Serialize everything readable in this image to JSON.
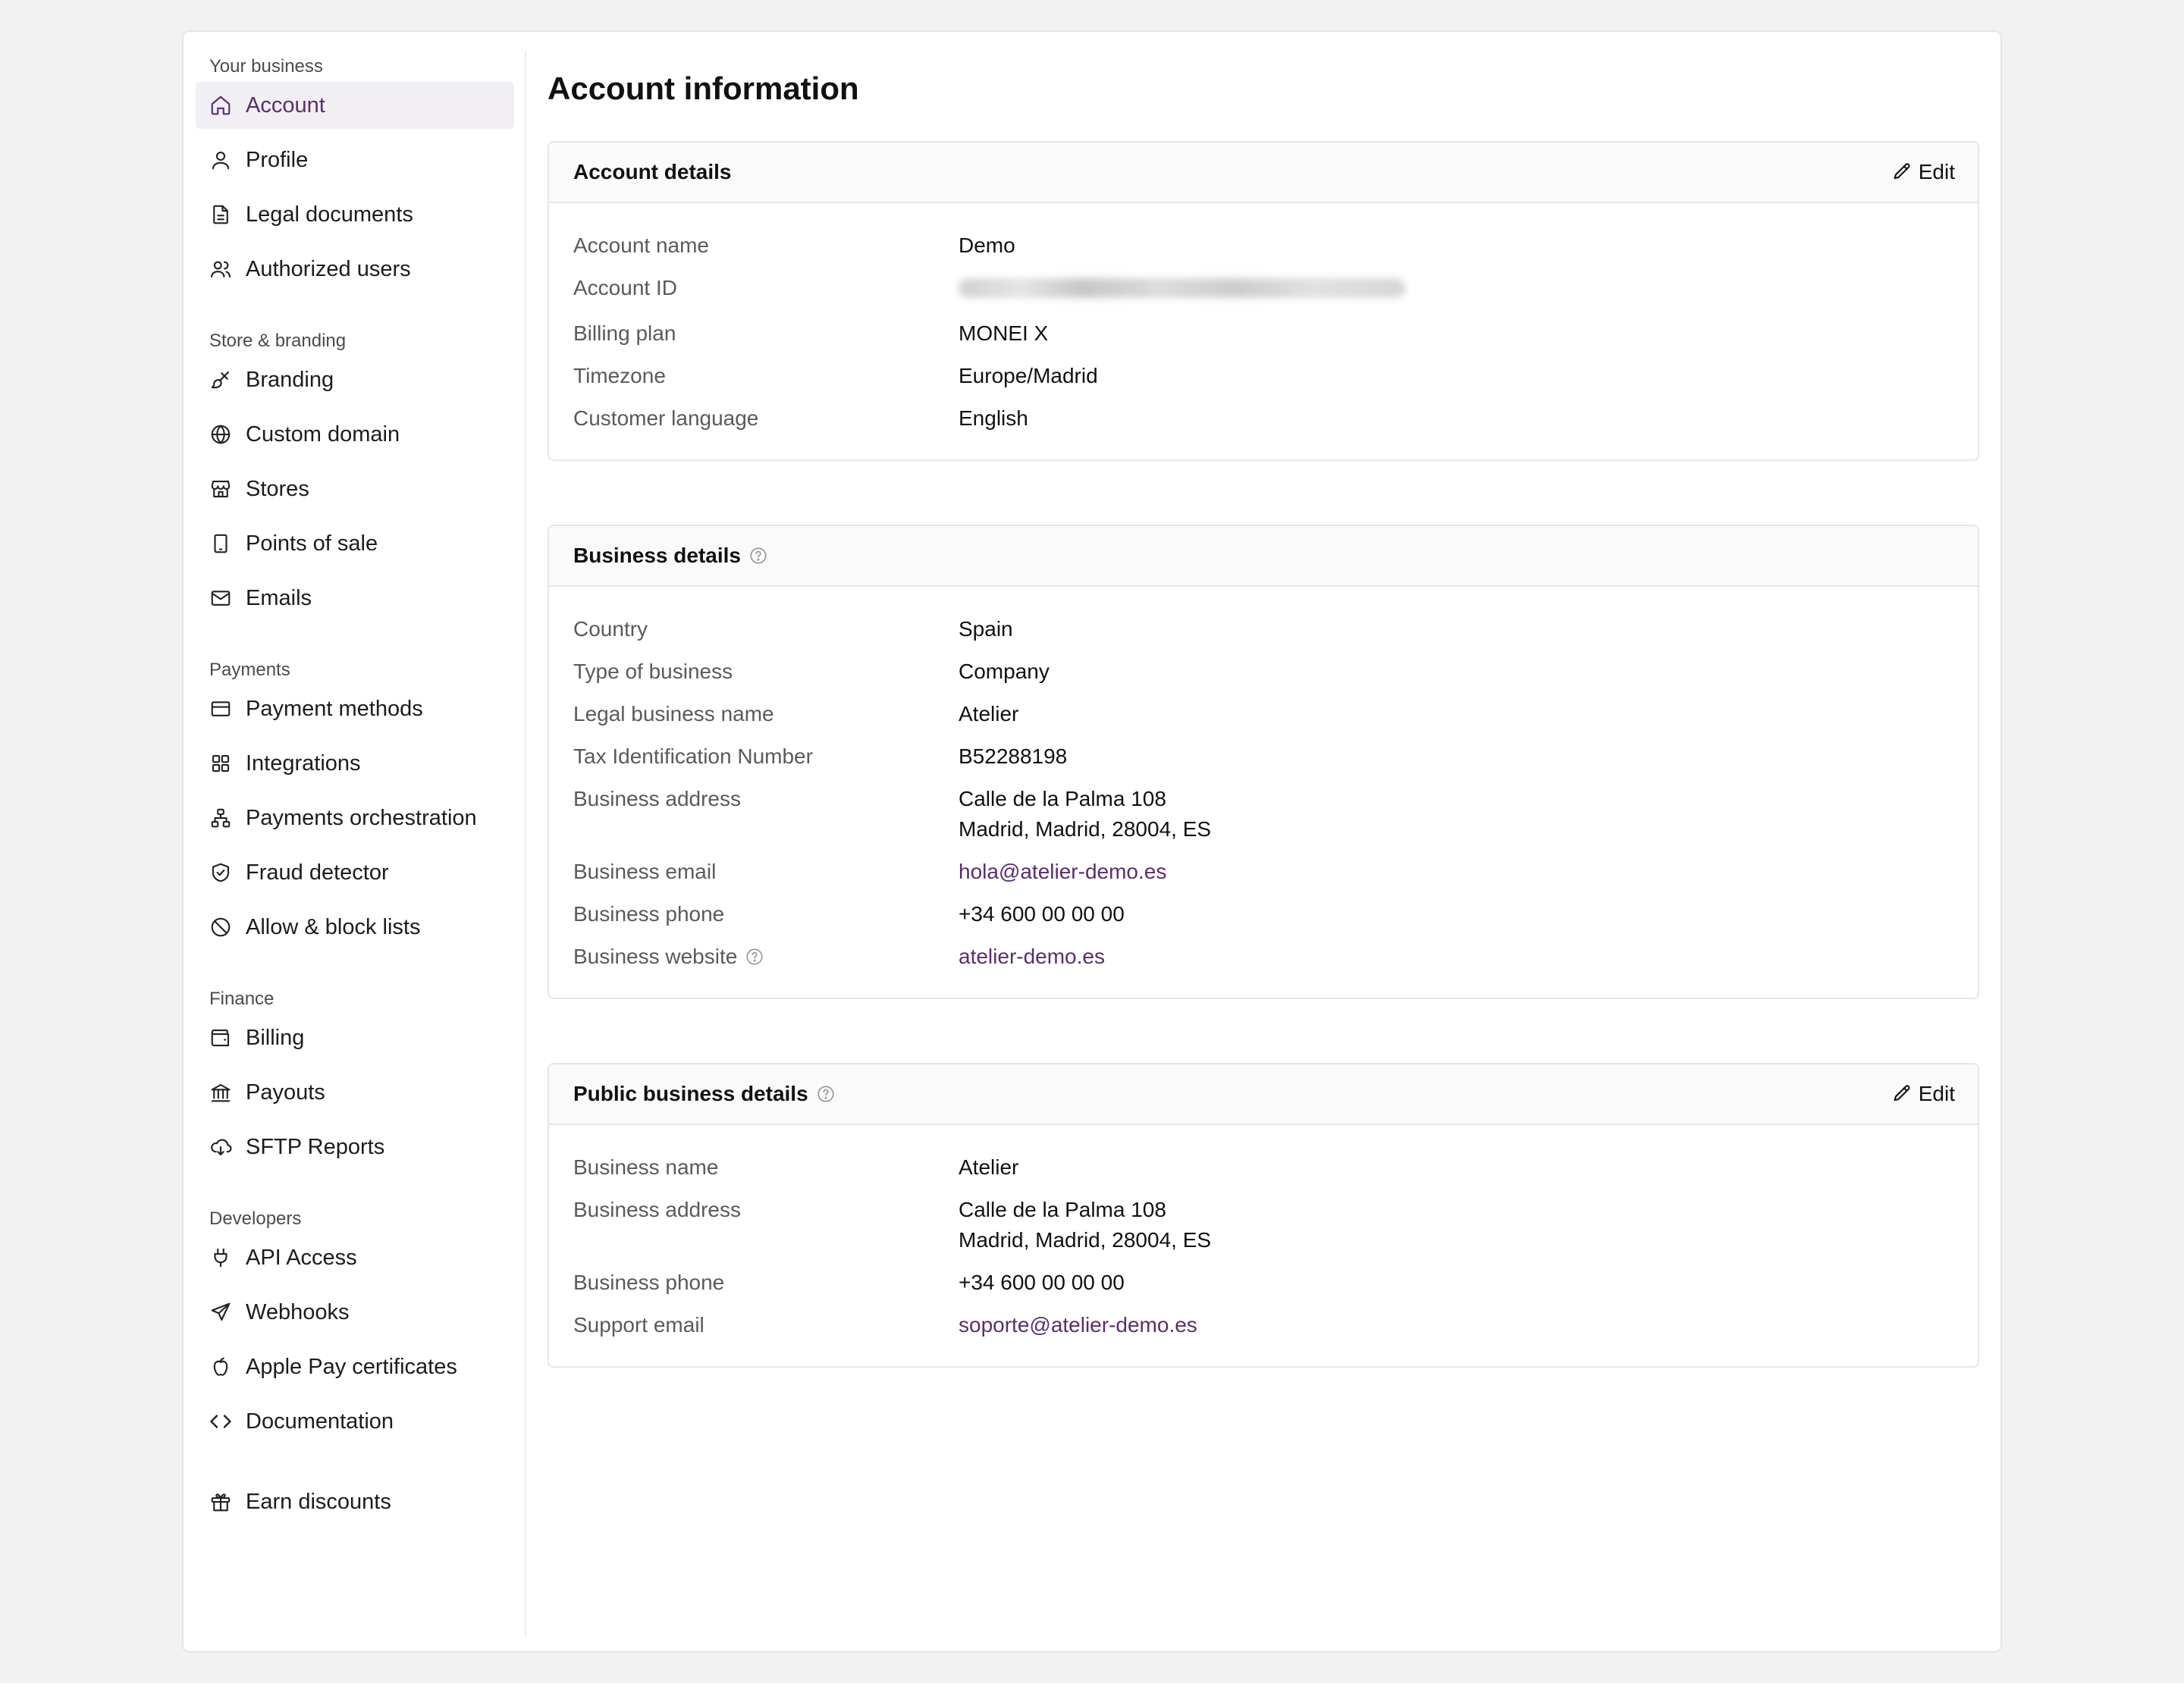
{
  "sidebar": {
    "sections": [
      {
        "heading": "Your business",
        "items": [
          {
            "label": "Account",
            "icon": "home-icon",
            "active": true
          },
          {
            "label": "Profile",
            "icon": "user-icon"
          },
          {
            "label": "Legal documents",
            "icon": "document-icon"
          },
          {
            "label": "Authorized users",
            "icon": "users-icon"
          }
        ]
      },
      {
        "heading": "Store & branding",
        "items": [
          {
            "label": "Branding",
            "icon": "paintbrush-icon"
          },
          {
            "label": "Custom domain",
            "icon": "globe-icon"
          },
          {
            "label": "Stores",
            "icon": "store-icon"
          },
          {
            "label": "Points of sale",
            "icon": "tablet-icon"
          },
          {
            "label": "Emails",
            "icon": "mail-icon"
          }
        ]
      },
      {
        "heading": "Payments",
        "items": [
          {
            "label": "Payment methods",
            "icon": "credit-card-icon"
          },
          {
            "label": "Integrations",
            "icon": "grid-icon"
          },
          {
            "label": "Payments orchestration",
            "icon": "network-icon"
          },
          {
            "label": "Fraud detector",
            "icon": "shield-check-icon"
          },
          {
            "label": "Allow & block lists",
            "icon": "ban-icon"
          }
        ]
      },
      {
        "heading": "Finance",
        "items": [
          {
            "label": "Billing",
            "icon": "wallet-icon"
          },
          {
            "label": "Payouts",
            "icon": "bank-icon"
          },
          {
            "label": "SFTP Reports",
            "icon": "cloud-download-icon"
          }
        ]
      },
      {
        "heading": "Developers",
        "items": [
          {
            "label": "API Access",
            "icon": "plug-icon"
          },
          {
            "label": "Webhooks",
            "icon": "send-icon"
          },
          {
            "label": "Apple Pay certificates",
            "icon": "apple-icon"
          },
          {
            "label": "Documentation",
            "icon": "code-icon"
          }
        ]
      },
      {
        "heading": "",
        "items": [
          {
            "label": "Earn discounts",
            "icon": "gift-icon"
          }
        ]
      }
    ]
  },
  "main": {
    "title": "Account information",
    "account_details": {
      "title": "Account details",
      "edit_label": "Edit",
      "rows": [
        {
          "label": "Account name",
          "value": "Demo"
        },
        {
          "label": "Account ID",
          "value": ""
        },
        {
          "label": "Billing plan",
          "value": "MONEI X"
        },
        {
          "label": "Timezone",
          "value": "Europe/Madrid"
        },
        {
          "label": "Customer language",
          "value": "English"
        }
      ]
    },
    "business_details": {
      "title": "Business details",
      "rows": [
        {
          "label": "Country",
          "value": "Spain"
        },
        {
          "label": "Type of business",
          "value": "Company"
        },
        {
          "label": "Legal business name",
          "value": "Atelier"
        },
        {
          "label": "Tax Identification Number",
          "value": "B52288198"
        },
        {
          "label": "Business address",
          "value": "Calle de la Palma 108",
          "value2": "Madrid, Madrid, 28004, ES"
        },
        {
          "label": "Business email",
          "value": "hola@atelier-demo.es"
        },
        {
          "label": "Business phone",
          "value": "+34 600 00 00 00"
        },
        {
          "label": "Business website",
          "value": "atelier-demo.es"
        }
      ]
    },
    "public_business_details": {
      "title": "Public business details",
      "edit_label": "Edit",
      "rows": [
        {
          "label": "Business name",
          "value": "Atelier"
        },
        {
          "label": "Business address",
          "value": "Calle de la Palma 108",
          "value2": "Madrid, Madrid, 28004, ES"
        },
        {
          "label": "Business phone",
          "value": "+34 600 00 00 00"
        },
        {
          "label": "Support email",
          "value": "soporte@atelier-demo.es"
        }
      ]
    }
  },
  "colors": {
    "accent": "#5b2d6e",
    "active_bg": "#f1eff4",
    "page_bg": "#f2f2f2",
    "border": "#e6e6e6"
  }
}
